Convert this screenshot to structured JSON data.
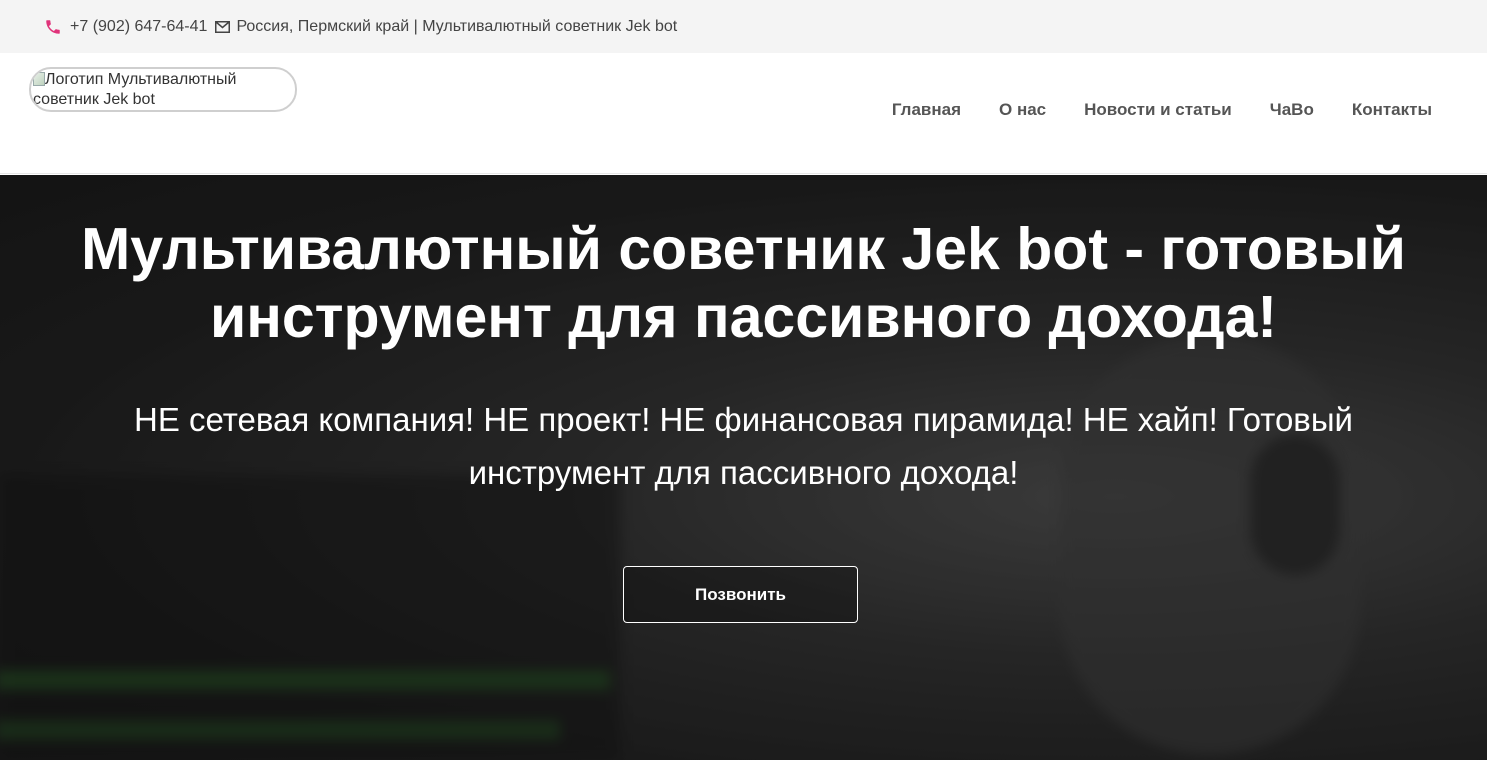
{
  "topbar": {
    "phone": "+7 (902) 647-64-41",
    "address": "Россия, Пермский край | Мультивалютный советник Jek bot",
    "phone_icon": "phone-icon",
    "mail_icon": "mail-icon",
    "phone_icon_color": "#e0337a"
  },
  "header": {
    "logo_alt": "Логотип Мультивалютный советник Jek bot",
    "nav": [
      {
        "label": "Главная"
      },
      {
        "label": "О нас"
      },
      {
        "label": "Новости и статьи"
      },
      {
        "label": "ЧаВо"
      },
      {
        "label": "Контакты"
      }
    ]
  },
  "hero": {
    "title": "Мультивалютный советник Jek bot - готовый инструмент для пассивного дохода!",
    "subtitle": "НЕ сетевая компания! НЕ проект! НЕ финансовая пирамида! НЕ хайп! Готовый инструмент для пассивного дохода!",
    "button_label": "Позвонить"
  }
}
